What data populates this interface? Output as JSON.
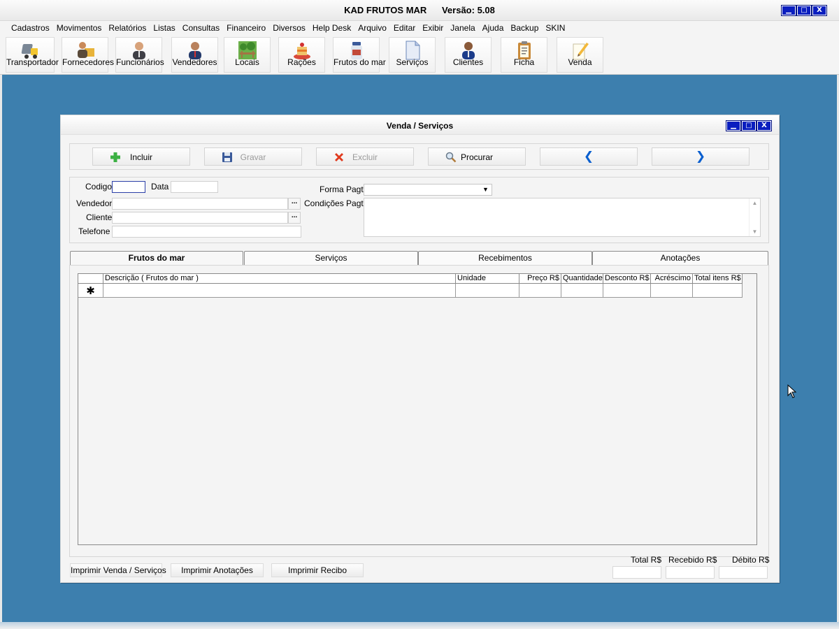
{
  "app": {
    "title": "KAD FRUTOS MAR      Versão: 5.08",
    "window_controls": [
      "▁",
      "□",
      "X"
    ]
  },
  "menu": [
    "Cadastros",
    "Movimentos",
    "Relatórios",
    "Listas",
    "Consultas",
    "Financeiro",
    "Diversos",
    "Help Desk",
    "Arquivo",
    "Editar",
    "Exibir",
    "Janela",
    "Ajuda",
    "Backup",
    "SKIN"
  ],
  "toolbar": [
    {
      "label": "Transportador",
      "icon": "truck-icon"
    },
    {
      "label": "Fornecedores",
      "icon": "suppliers-icon"
    },
    {
      "label": "Funcionários",
      "icon": "employee-icon"
    },
    {
      "label": "Vendedores",
      "icon": "salesperson-icon"
    },
    {
      "label": "Locais",
      "icon": "location-icon"
    },
    {
      "label": "Rações",
      "icon": "food-icon"
    },
    {
      "label": "Frutos do mar",
      "icon": "seafood-jar-icon"
    },
    {
      "label": "Serviços",
      "icon": "document-icon"
    },
    {
      "label": "Clientes",
      "icon": "customer-icon"
    },
    {
      "label": "Ficha",
      "icon": "clipboard-icon"
    },
    {
      "label": "Venda",
      "icon": "pencil-paper-icon"
    }
  ],
  "child_window": {
    "title": "Venda / Serviços",
    "window_controls": [
      "▁",
      "□",
      "X"
    ]
  },
  "actions": {
    "incluir": "Incluir",
    "gravar": "Gravar",
    "excluir": "Excluir",
    "procurar": "Procurar",
    "prev": "❮",
    "next": "❯"
  },
  "form": {
    "codigo_label": "Codigo",
    "codigo_value": "",
    "data_label": "Data",
    "data_value": "",
    "vendedor_label": "Vendedor",
    "vendedor_value": "",
    "cliente_label": "Cliente",
    "cliente_value": "",
    "telefone_label": "Telefone",
    "telefone_value": "",
    "forma_pagto_label": "Forma Pagto",
    "forma_pagto_value": "",
    "condicoes_pagto_label": "Condições Pagto",
    "condicoes_pagto_value": "",
    "ellipsis": "..."
  },
  "tabs": [
    "Frutos do mar",
    "Serviços",
    "Recebimentos",
    "Anotações"
  ],
  "grid": {
    "columns": [
      "Descrição ( Frutos do mar )",
      "Unidade",
      "Preço R$",
      "Quantidade",
      "Desconto R$",
      "Acréscimo",
      "Total itens R$"
    ],
    "new_row_marker": "✱"
  },
  "bottom": {
    "print_sale": "Imprimir Venda / Serviços",
    "print_notes": "Imprimir Anotações",
    "print_receipt": "Imprimir Recibo",
    "total_label": "Total R$",
    "recebido_label": "Recebido R$",
    "debito_label": "Débito R$",
    "total_value": "",
    "recebido_value": "",
    "debito_value": ""
  }
}
